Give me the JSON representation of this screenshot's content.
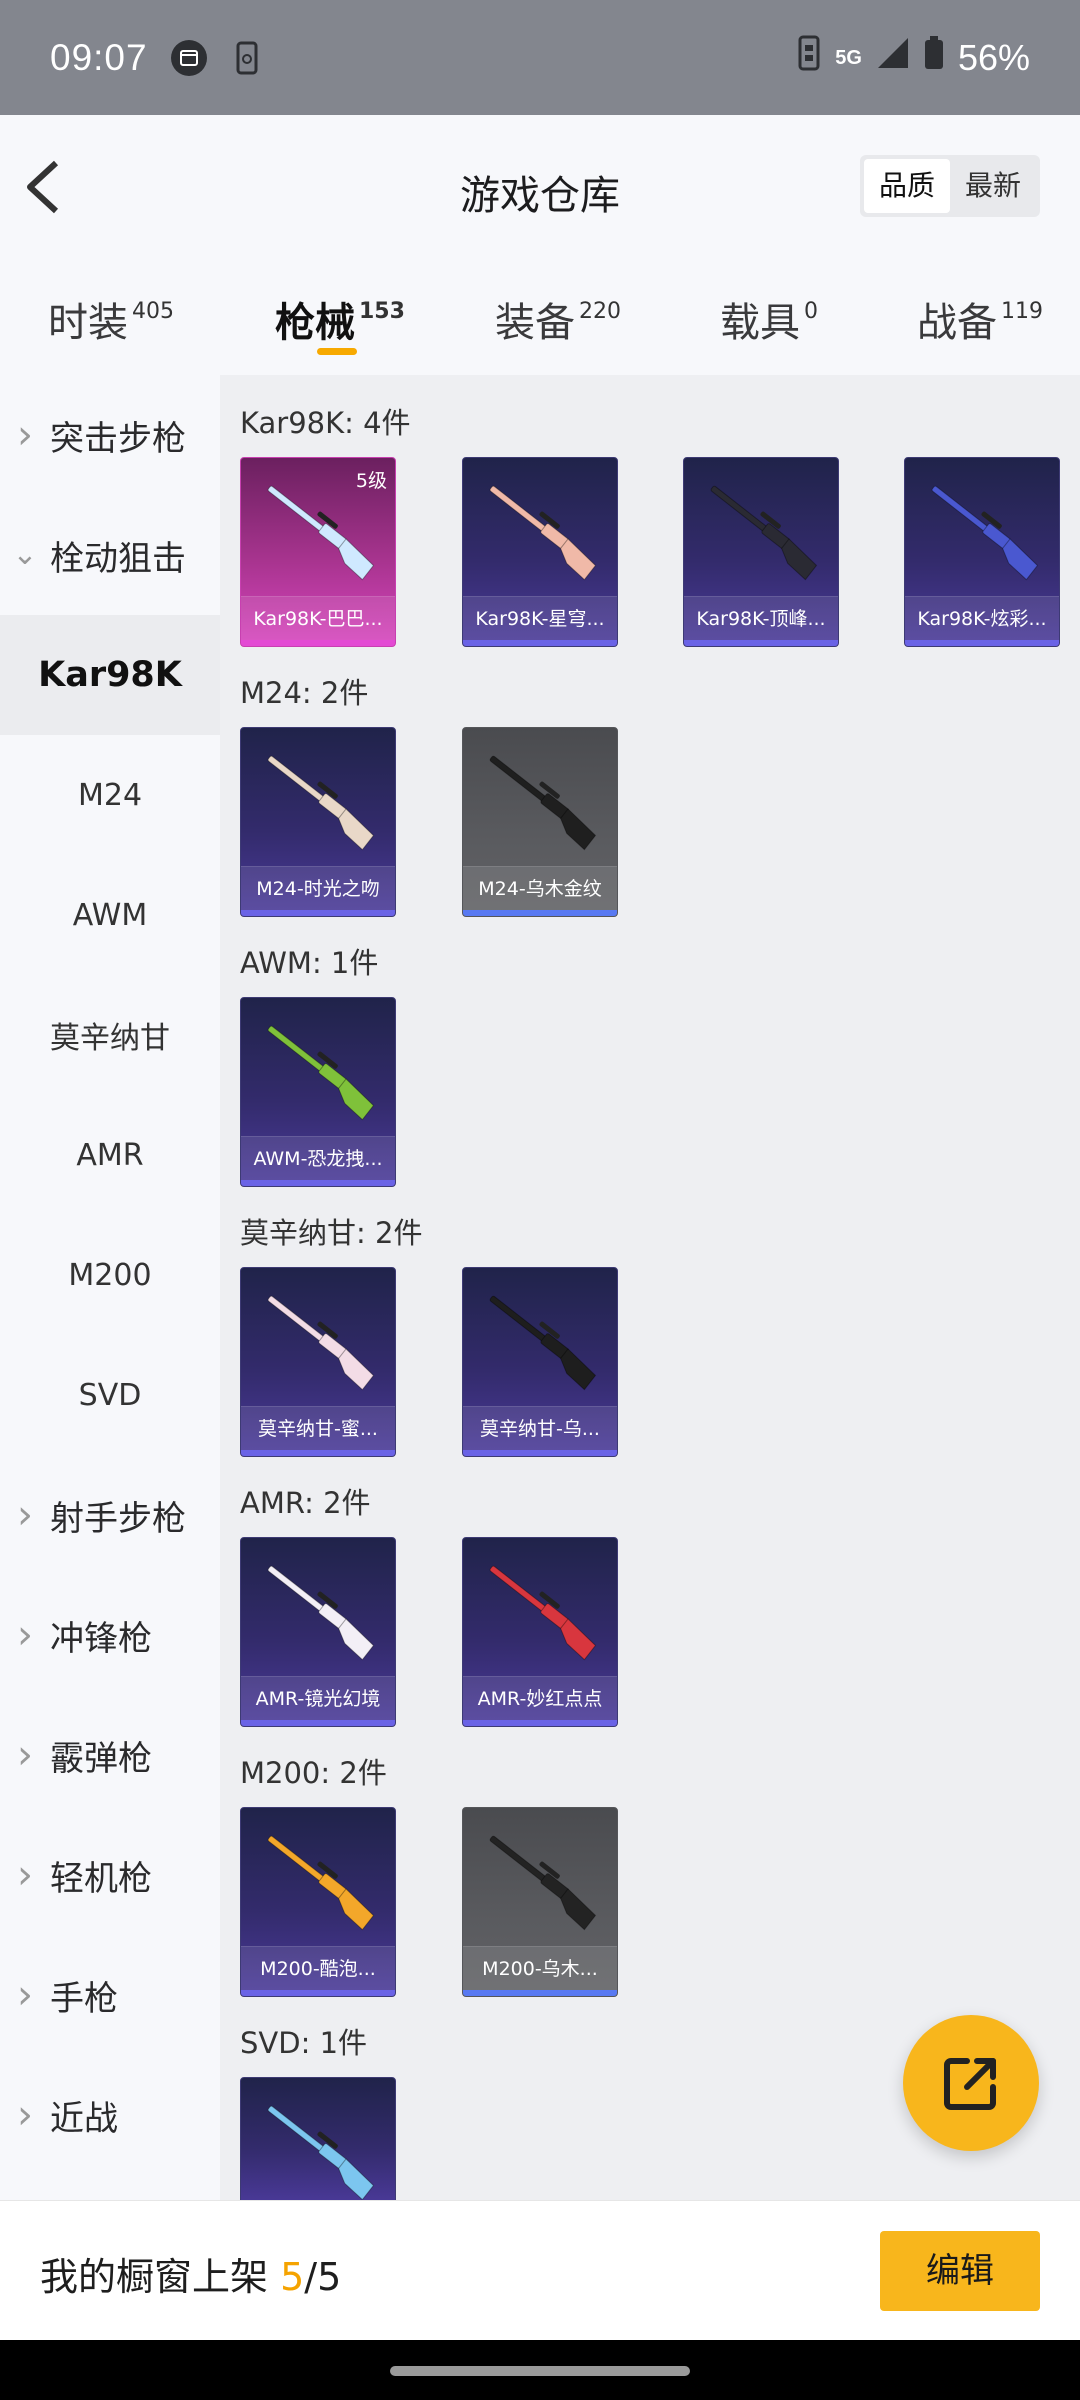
{
  "status_bar": {
    "time": "09:07",
    "network": "5G",
    "battery": "56%"
  },
  "header": {
    "title": "游戏仓库",
    "sort_options": [
      "品质",
      "最新"
    ],
    "sort_selected": "品质"
  },
  "tabs": [
    {
      "label": "时装",
      "count": "405"
    },
    {
      "label": "枪械",
      "count": "153",
      "active": true
    },
    {
      "label": "装备",
      "count": "220"
    },
    {
      "label": "载具",
      "count": "0"
    },
    {
      "label": "战备",
      "count": "119"
    }
  ],
  "sidebar": {
    "items": [
      {
        "label": "突击步枪",
        "expandable": true
      },
      {
        "label": "栓动狙击",
        "expandable": true,
        "expanded": true
      },
      {
        "label": "Kar98K",
        "sub": true,
        "selected": true
      },
      {
        "label": "M24",
        "sub": true
      },
      {
        "label": "AWM",
        "sub": true
      },
      {
        "label": "莫辛纳甘",
        "sub": true
      },
      {
        "label": "AMR",
        "sub": true
      },
      {
        "label": "M200",
        "sub": true
      },
      {
        "label": "SVD",
        "sub": true
      },
      {
        "label": "射手步枪",
        "expandable": true
      },
      {
        "label": "冲锋枪",
        "expandable": true
      },
      {
        "label": "霰弹枪",
        "expandable": true
      },
      {
        "label": "轻机枪",
        "expandable": true
      },
      {
        "label": "手枪",
        "expandable": true
      },
      {
        "label": "近战",
        "expandable": true
      }
    ]
  },
  "sections": [
    {
      "title": "Kar98K: 4件",
      "items": [
        {
          "label": "Kar98K-巴巴...",
          "rarity": "legendary",
          "level": "5级",
          "weapon_color": "#cfe9ff"
        },
        {
          "label": "Kar98K-星穹...",
          "rarity": "epic",
          "weapon_color": "#f0b9a8"
        },
        {
          "label": "Kar98K-顶峰...",
          "rarity": "epic",
          "weapon_color": "#2a2a33"
        },
        {
          "label": "Kar98K-炫彩...",
          "rarity": "epic",
          "weapon_color": "#4a58d0"
        }
      ]
    },
    {
      "title": "M24: 2件",
      "items": [
        {
          "label": "M24-时光之吻",
          "rarity": "epic",
          "weapon_color": "#e9d8c8"
        },
        {
          "label": "M24-乌木金纹",
          "rarity": "rare",
          "weapon_color": "#1f1f1f"
        }
      ]
    },
    {
      "title": "AWM: 1件",
      "items": [
        {
          "label": "AWM-恐龙拽...",
          "rarity": "epic",
          "weapon_color": "#7fc13a"
        }
      ]
    },
    {
      "title": "莫辛纳甘: 2件",
      "items": [
        {
          "label": "莫辛纳甘-蜜...",
          "rarity": "epic",
          "weapon_color": "#f3dce6"
        },
        {
          "label": "莫辛纳甘-乌...",
          "rarity": "epic",
          "weapon_color": "#1e1e1e"
        }
      ]
    },
    {
      "title": "AMR: 2件",
      "items": [
        {
          "label": "AMR-镜光幻境",
          "rarity": "epic",
          "weapon_color": "#f3eff6"
        },
        {
          "label": "AMR-妙红点点",
          "rarity": "epic",
          "weapon_color": "#d8363e"
        }
      ]
    },
    {
      "title": "M200: 2件",
      "items": [
        {
          "label": "M200-酷泡...",
          "rarity": "epic",
          "weapon_color": "#f3a72a"
        },
        {
          "label": "M200-乌木...",
          "rarity": "rare",
          "weapon_color": "#232323"
        }
      ]
    },
    {
      "title": "SVD: 1件",
      "items": [
        {
          "label": "",
          "rarity": "epic",
          "weapon_color": "#7cc6ef"
        }
      ]
    }
  ],
  "bottom_bar": {
    "label": "我的橱窗上架",
    "current": "5",
    "total": "/5",
    "edit_label": "编辑"
  },
  "colors": {
    "accent": "#f8b61c",
    "epic": "#6a63e6",
    "legendary": "#e34ad4",
    "rare": "#5879f2"
  },
  "icons": [
    "calendar-icon",
    "phone-icon",
    "sim-icon",
    "signal-icon",
    "battery-icon",
    "back-arrow-icon",
    "chevron-right-icon",
    "chevron-down-icon",
    "share-external-icon"
  ]
}
